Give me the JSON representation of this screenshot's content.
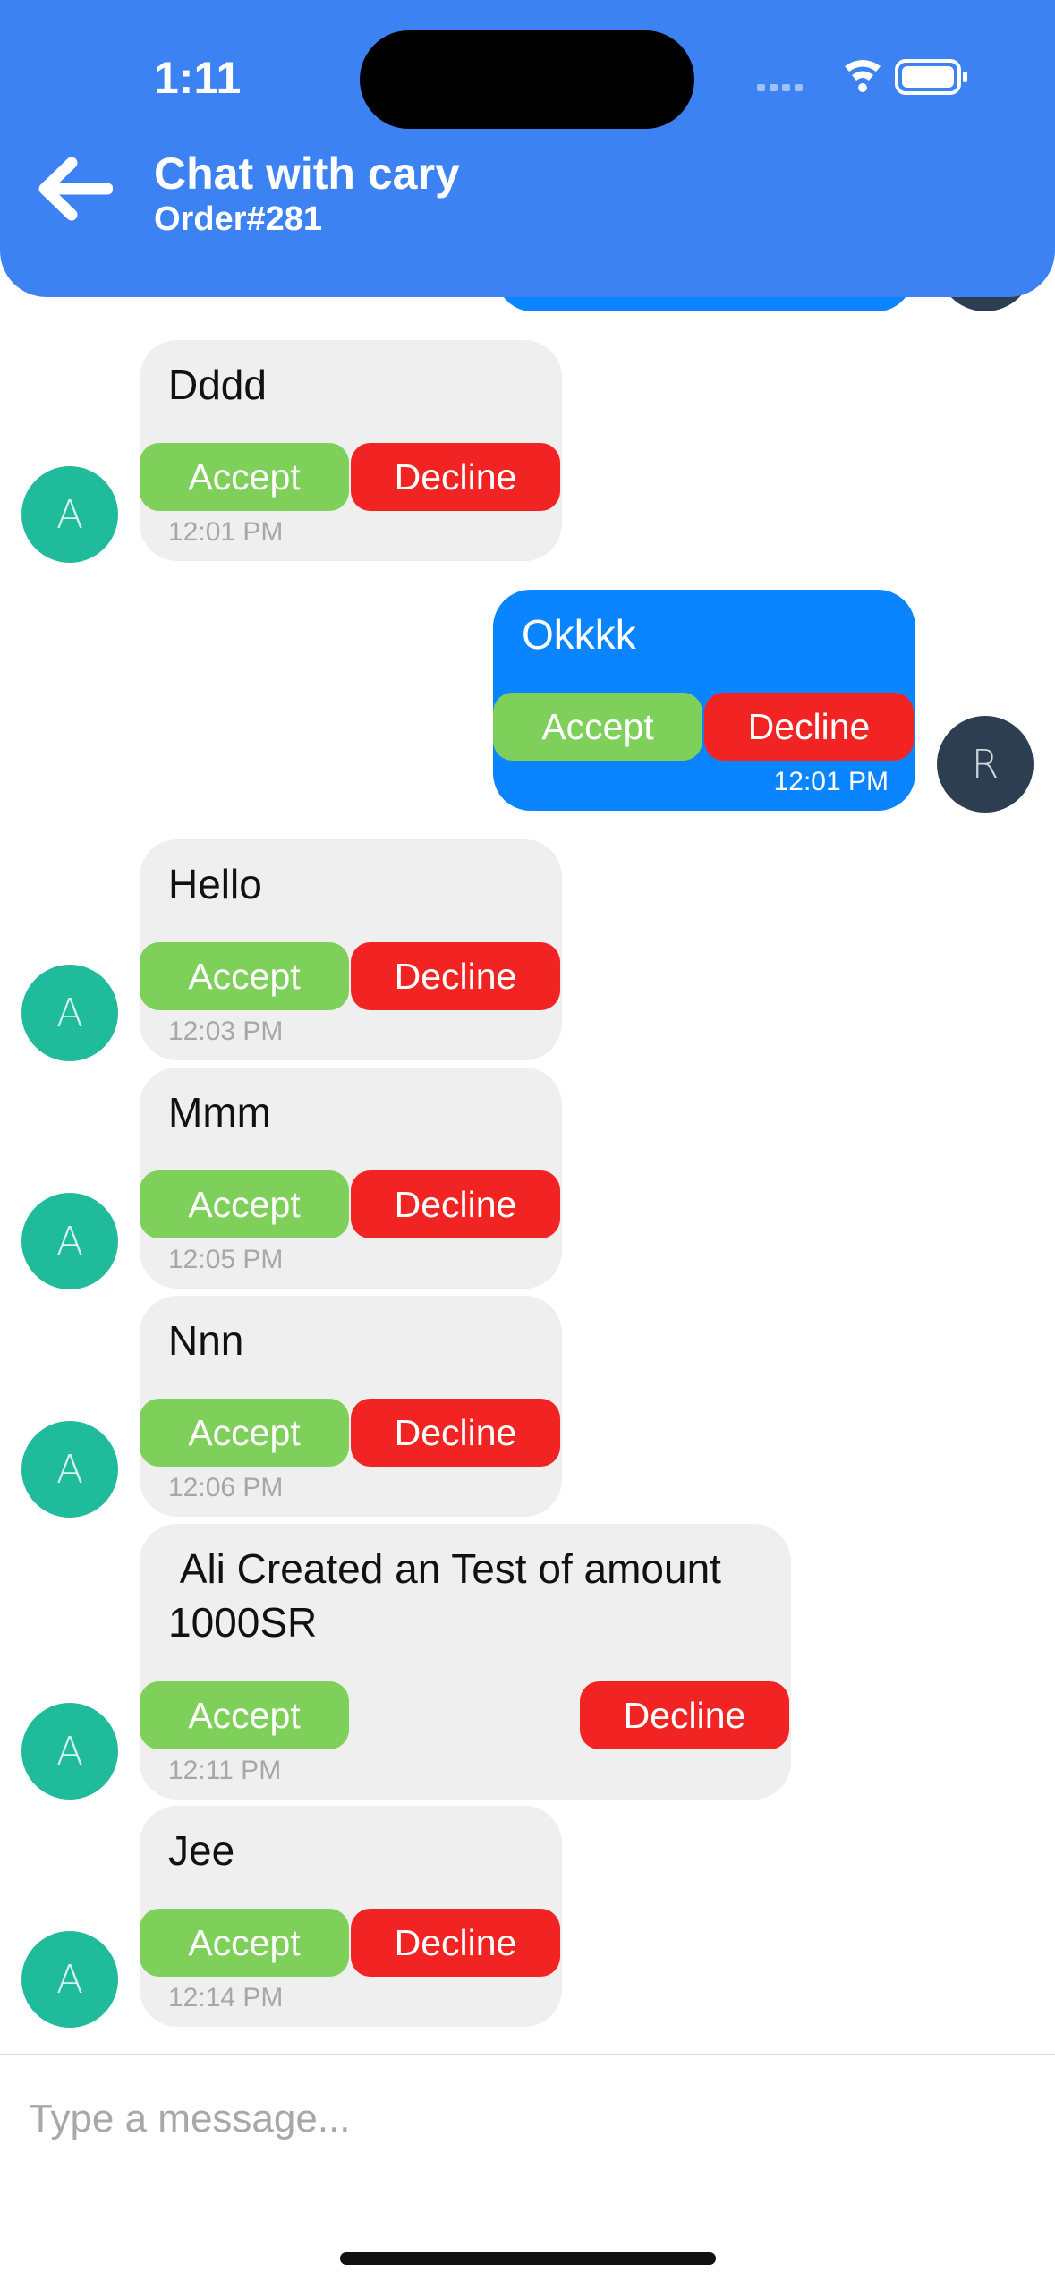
{
  "status_bar": {
    "time": "1:11"
  },
  "header": {
    "title": "Chat with cary",
    "subtitle": "Order#281"
  },
  "buttons": {
    "accept": "Accept",
    "decline": "Decline"
  },
  "avatars": {
    "other": "A",
    "me": "R"
  },
  "messages": [
    {
      "text": "Dddd",
      "time": "12:01 PM",
      "sender": "other"
    },
    {
      "text": "Okkkk",
      "time": "12:01 PM",
      "sender": "me"
    },
    {
      "text": "Hello",
      "time": "12:03 PM",
      "sender": "other"
    },
    {
      "text": "Mmm",
      "time": "12:05 PM",
      "sender": "other"
    },
    {
      "text": "Nnn",
      "time": "12:06 PM",
      "sender": "other"
    },
    {
      "text": " Ali Created an Test of amount 1000SR",
      "time": "12:11 PM",
      "sender": "other"
    },
    {
      "text": "Jee",
      "time": "12:14 PM",
      "sender": "other"
    }
  ],
  "input": {
    "placeholder": "Type a message..."
  },
  "colors": {
    "header": "#3d82f2",
    "my_bubble": "#0a84ff",
    "other_bubble": "#efefef",
    "accept": "#7fd05a",
    "decline": "#f22323",
    "avatar_other": "#1fbb9b",
    "avatar_me": "#2c3e50"
  }
}
